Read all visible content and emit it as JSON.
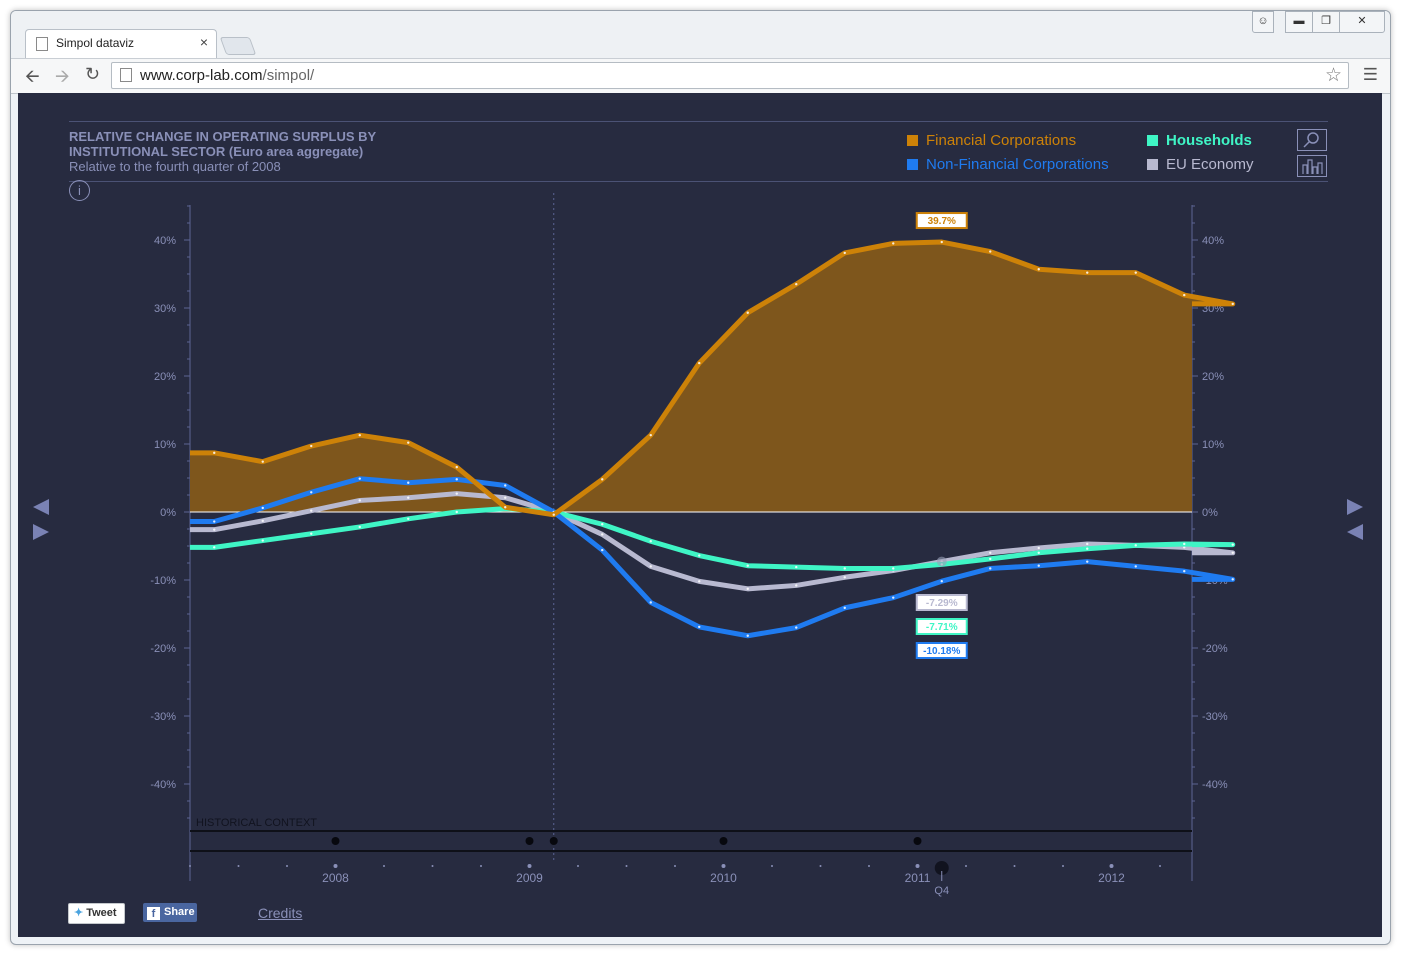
{
  "browser": {
    "tab_title": "Simpol dataviz",
    "tab_close": "×",
    "url_host": "www.corp-lab.com",
    "url_path": "/simpol/"
  },
  "page": {
    "title_line1": "RELATIVE CHANGE IN OPERATING SURPLUS BY",
    "title_line2": "INSTITUTIONAL SECTOR (Euro area aggregate)",
    "subtitle": "Relative to the fourth quarter of 2008",
    "info": "i",
    "legend": [
      {
        "label": "Financial Corporations",
        "color": "#cd8208"
      },
      {
        "label": "Households",
        "color": "#3ff5c5"
      },
      {
        "label": "Non-Financial Corporations",
        "color": "#1f7bf0"
      },
      {
        "label": "EU Economy",
        "color": "#b8b9d0"
      }
    ],
    "historical_context": "HISTORICAL CONTEXT",
    "tweet": "Tweet",
    "share": "Share",
    "credits": "Credits"
  },
  "chart_data": {
    "type": "line",
    "title": "RELATIVE CHANGE IN OPERATING SURPLUS BY INSTITUTIONAL SECTOR (Euro area aggregate)",
    "subtitle": "Relative to the fourth quarter of 2008",
    "x": [
      "2007-Q2",
      "2007-Q3",
      "2007-Q4",
      "2008-Q1",
      "2008-Q2",
      "2008-Q3",
      "2008-Q4",
      "2009-Q1",
      "2009-Q2",
      "2009-Q3",
      "2009-Q4",
      "2010-Q1",
      "2010-Q2",
      "2010-Q3",
      "2010-Q4",
      "2011-Q1",
      "2011-Q2",
      "2011-Q3",
      "2011-Q4",
      "2012-Q1",
      "2012-Q2",
      "2012-Q3"
    ],
    "x_ticks": [
      "2008",
      "2009",
      "2010",
      "2011",
      "2012"
    ],
    "y_ticks": [
      "40%",
      "30%",
      "20%",
      "10%",
      "0%",
      "-10%",
      "-20%",
      "-30%",
      "-40%"
    ],
    "ylim": [
      -45,
      45
    ],
    "x_offset_first": 0.5,
    "series": [
      {
        "name": "Financial Corporations",
        "color": "#cd8208",
        "area": true,
        "values": [
          8.7,
          7.4,
          9.7,
          11.3,
          10.2,
          6.6,
          0.7,
          -0.4,
          4.8,
          11.3,
          21.9,
          29.3,
          33.5,
          38.1,
          39.5,
          39.7,
          38.3,
          35.7,
          35.2,
          35.2,
          31.9,
          30.6
        ]
      },
      {
        "name": "Households",
        "color": "#3ff5c5",
        "values": [
          -5.2,
          -4.2,
          -3.2,
          -2.2,
          -1.0,
          0.0,
          0.5,
          0.0,
          -1.8,
          -4.3,
          -6.4,
          -7.9,
          -8.1,
          -8.3,
          -8.3,
          -7.71,
          -6.9,
          -6.0,
          -5.4,
          -4.9,
          -4.7,
          -4.8
        ]
      },
      {
        "name": "Non-Financial Corporations",
        "color": "#1f7bf0",
        "values": [
          -1.4,
          0.6,
          2.9,
          4.9,
          4.3,
          4.8,
          3.9,
          0.0,
          -5.6,
          -13.3,
          -16.9,
          -18.2,
          -17.0,
          -14.1,
          -12.6,
          -10.18,
          -8.3,
          -7.9,
          -7.3,
          -8.0,
          -8.7,
          -9.9
        ]
      },
      {
        "name": "EU Economy",
        "color": "#b8b9d0",
        "values": [
          -2.6,
          -1.3,
          0.2,
          1.7,
          2.1,
          2.7,
          2.1,
          0.0,
          -3.3,
          -8.0,
          -10.2,
          -11.3,
          -10.8,
          -9.6,
          -8.6,
          -7.29,
          -6.0,
          -5.3,
          -4.7,
          -4.9,
          -5.2,
          -6.0
        ]
      }
    ],
    "highlight": {
      "index": 15,
      "quarter_label": "Q4",
      "labels": [
        {
          "series": 0,
          "text": "39.7%"
        },
        {
          "series": 3,
          "text": "-7.29%"
        },
        {
          "series": 1,
          "text": "-7.71%"
        },
        {
          "series": 2,
          "text": "-10.18%"
        }
      ]
    },
    "baseline_index": 7,
    "historical_events": [
      2.5,
      6.5,
      7.0,
      10.5,
      14.5
    ],
    "grid": false,
    "legend_position": "top-right"
  }
}
